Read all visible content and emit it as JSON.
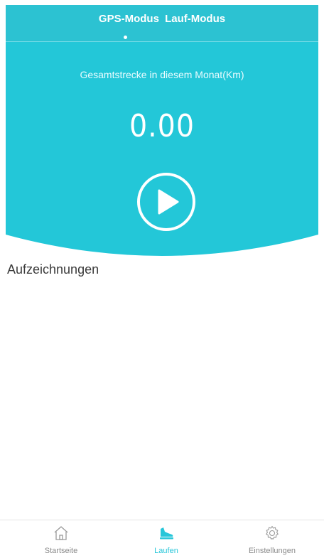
{
  "header": {
    "tabs": [
      {
        "label": "GPS-Modus",
        "active": true
      },
      {
        "label": "Lauf-Modus",
        "active": false
      }
    ]
  },
  "hero": {
    "label": "Gesamtstrecke in diesem Monat(Km)",
    "value": "0.00",
    "play_icon": "play-icon"
  },
  "records": {
    "title": "Aufzeichnungen"
  },
  "tabbar": {
    "items": [
      {
        "label": "Startseite",
        "icon": "home-icon",
        "active": false
      },
      {
        "label": "Laufen",
        "icon": "running-shoe-icon",
        "active": true
      },
      {
        "label": "Einstellungen",
        "icon": "gear-icon",
        "active": false
      }
    ]
  },
  "colors": {
    "accent": "#23c7d8",
    "active_tab": "#27c6d9",
    "inactive_tab": "#8a8a8a"
  }
}
